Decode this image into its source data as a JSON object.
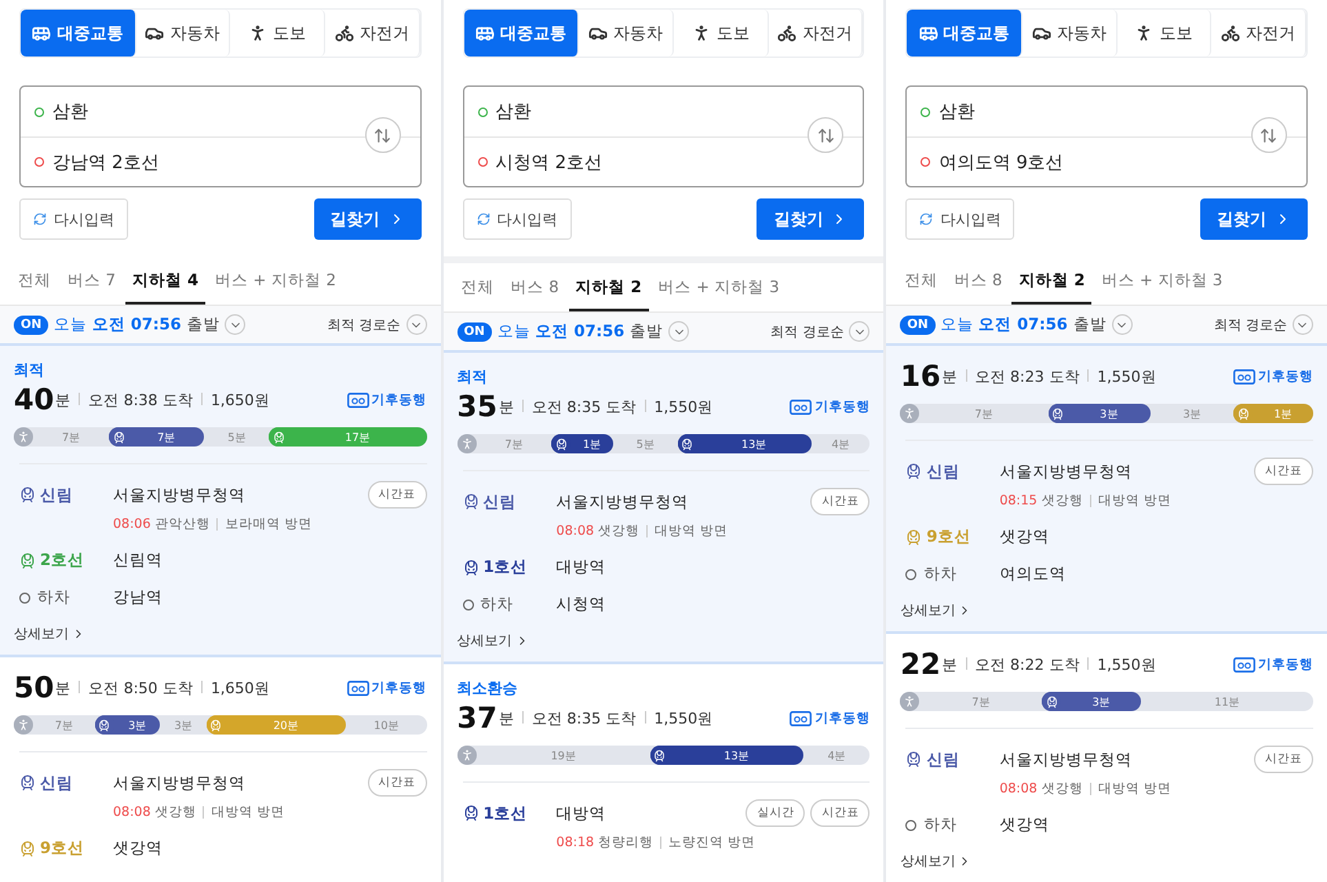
{
  "panels": [
    {
      "modes": [
        {
          "kind": "transit",
          "label": "대중교통",
          "selected": true
        },
        {
          "kind": "car",
          "label": "자동차",
          "selected": false
        },
        {
          "kind": "walk",
          "label": "도보",
          "selected": false
        },
        {
          "kind": "bike",
          "label": "자전거",
          "selected": false
        }
      ],
      "origin": "삼환",
      "destination": "강남역 2호선",
      "reset_button": "다시입력",
      "search_button": "길찾기",
      "tabs": [
        {
          "label": "전체",
          "selected": false
        },
        {
          "label": "버스 7",
          "selected": false
        },
        {
          "label": "지하철 4",
          "selected": true
        },
        {
          "label": "버스 + 지하철 2",
          "selected": false
        }
      ],
      "departure": {
        "on": true,
        "toggle": "ON",
        "time": "오늘 **오전 07:56**",
        "suffix": "출발"
      },
      "sort": "최적 경로순",
      "routes": [
        {
          "selected": true,
          "tag": "최적",
          "minutes": "40",
          "unit": "분",
          "arrival": "오전 8:38 도착",
          "fare": "1,650원",
          "badge": "기후동행",
          "segments": [
            {
              "kind": "walk",
              "label": "7분"
            },
            {
              "kind": "ride",
              "label": "7분",
              "color": "#4b5aa8"
            },
            {
              "kind": "gap",
              "label": "5분"
            },
            {
              "kind": "ride",
              "label": "17분",
              "color": "#3cb44b"
            }
          ],
          "steps": [
            {
              "kind": "board",
              "line": "신림",
              "color": "#4b5aa8",
              "station": "서울지방병무청역",
              "time": "08:06",
              "direction": "관악산행",
              "platform": "보라매역 방면",
              "buttons": [
                "시간표"
              ]
            },
            {
              "kind": "board",
              "line": "2호선",
              "color": "#3ca54b",
              "station": "신림역"
            },
            {
              "kind": "alight",
              "line": "하차",
              "station": "강남역"
            }
          ],
          "detail": "상세보기"
        },
        {
          "selected": false,
          "minutes": "50",
          "unit": "분",
          "arrival": "오전 8:50 도착",
          "fare": "1,650원",
          "badge": "기후동행",
          "segments": [
            {
              "kind": "walk",
              "label": "7분"
            },
            {
              "kind": "ride",
              "label": "3분",
              "color": "#4b5aa8"
            },
            {
              "kind": "gap",
              "label": "3분"
            },
            {
              "kind": "ride",
              "label": "20분",
              "color": "#d4a62a"
            },
            {
              "kind": "gap",
              "label": "10분"
            }
          ],
          "steps": [
            {
              "kind": "board",
              "line": "신림",
              "color": "#4b5aa8",
              "station": "서울지방병무청역",
              "time": "08:08",
              "direction": "샛강행",
              "platform": "대방역 방면",
              "buttons": [
                "시간표"
              ]
            },
            {
              "kind": "board",
              "line": "9호선",
              "color": "#c9a030",
              "station": "샛강역"
            }
          ]
        }
      ]
    },
    {
      "modes": [
        {
          "kind": "transit",
          "label": "대중교통",
          "selected": true
        },
        {
          "kind": "car",
          "label": "자동차",
          "selected": false
        },
        {
          "kind": "walk",
          "label": "도보",
          "selected": false
        },
        {
          "kind": "bike",
          "label": "자전거",
          "selected": false
        }
      ],
      "origin": "삼환",
      "destination": "시청역 2호선",
      "reset_button": "다시입력",
      "search_button": "길찾기",
      "tabs": [
        {
          "label": "전체",
          "selected": false
        },
        {
          "label": "버스 8",
          "selected": false
        },
        {
          "label": "지하철 2",
          "selected": true
        },
        {
          "label": "버스 + 지하철 3",
          "selected": false
        }
      ],
      "departure": {
        "on": true,
        "toggle": "ON",
        "time": "오늘 **오전 07:56**",
        "suffix": "출발"
      },
      "sort": "최적 경로순",
      "routes": [
        {
          "selected": true,
          "tag": "최적",
          "minutes": "35",
          "unit": "분",
          "arrival": "오전 8:35 도착",
          "fare": "1,550원",
          "badge": "기후동행",
          "segments": [
            {
              "kind": "walk",
              "label": "7분"
            },
            {
              "kind": "ride",
              "label": "1분",
              "color": "#2a3f9a"
            },
            {
              "kind": "gap",
              "label": "5분"
            },
            {
              "kind": "ride",
              "label": "13분",
              "color": "#2a3f9a"
            },
            {
              "kind": "gap",
              "label": "4분"
            }
          ],
          "steps": [
            {
              "kind": "board",
              "line": "신림",
              "color": "#4b5aa8",
              "station": "서울지방병무청역",
              "time": "08:08",
              "direction": "샛강행",
              "platform": "대방역 방면",
              "buttons": [
                "시간표"
              ]
            },
            {
              "kind": "board",
              "line": "1호선",
              "color": "#2a3f9a",
              "station": "대방역"
            },
            {
              "kind": "alight",
              "line": "하차",
              "station": "시청역"
            }
          ],
          "detail": "상세보기"
        },
        {
          "selected": false,
          "tag": "최소환승",
          "minutes": "37",
          "unit": "분",
          "arrival": "오전 8:35 도착",
          "fare": "1,550원",
          "badge": "기후동행",
          "segments": [
            {
              "kind": "walk",
              "label": "19분"
            },
            {
              "kind": "ride",
              "label": "13분",
              "color": "#2a3f9a"
            },
            {
              "kind": "gap",
              "label": "4분"
            }
          ],
          "steps": [
            {
              "kind": "board",
              "line": "1호선",
              "color": "#2a3f9a",
              "station": "대방역",
              "time": "08:18",
              "direction": "청량리행",
              "platform": "노량진역 방면",
              "buttons": [
                "실시간",
                "시간표"
              ]
            }
          ]
        }
      ]
    },
    {
      "modes": [
        {
          "kind": "transit",
          "label": "대중교통",
          "selected": true
        },
        {
          "kind": "car",
          "label": "자동차",
          "selected": false
        },
        {
          "kind": "walk",
          "label": "도보",
          "selected": false
        },
        {
          "kind": "bike",
          "label": "자전거",
          "selected": false
        }
      ],
      "origin": "삼환",
      "destination": "여의도역 9호선",
      "reset_button": "다시입력",
      "search_button": "길찾기",
      "tabs": [
        {
          "label": "전체",
          "selected": false
        },
        {
          "label": "버스 8",
          "selected": false
        },
        {
          "label": "지하철 2",
          "selected": true
        },
        {
          "label": "버스 + 지하철 3",
          "selected": false
        }
      ],
      "departure": {
        "on": true,
        "toggle": "ON",
        "time": "오늘 **오전 07:56**",
        "suffix": "출발"
      },
      "sort": "최적 경로순",
      "routes": [
        {
          "selected": true,
          "minutes": "16",
          "unit": "분",
          "arrival": "오전 8:23 도착",
          "fare": "1,550원",
          "badge": "기후동행",
          "segments": [
            {
              "kind": "walk",
              "label": "7분"
            },
            {
              "kind": "ride",
              "label": "3분",
              "color": "#4b5aa8"
            },
            {
              "kind": "gap",
              "label": "3분"
            },
            {
              "kind": "ride",
              "label": "1분",
              "color": "#c9a030"
            }
          ],
          "steps": [
            {
              "kind": "board",
              "line": "신림",
              "color": "#4b5aa8",
              "station": "서울지방병무청역",
              "time": "08:15",
              "direction": "샛강행",
              "platform": "대방역 방면",
              "buttons": [
                "시간표"
              ]
            },
            {
              "kind": "board",
              "line": "9호선",
              "color": "#c9a030",
              "station": "샛강역"
            },
            {
              "kind": "alight",
              "line": "하차",
              "station": "여의도역"
            }
          ],
          "detail": "상세보기"
        },
        {
          "selected": false,
          "minutes": "22",
          "unit": "분",
          "arrival": "오전 8:22 도착",
          "fare": "1,550원",
          "badge": "기후동행",
          "segments": [
            {
              "kind": "walk",
              "label": "7분"
            },
            {
              "kind": "ride",
              "label": "3분",
              "color": "#4b5aa8"
            },
            {
              "kind": "gap",
              "label": "11분"
            }
          ],
          "steps": [
            {
              "kind": "board",
              "line": "신림",
              "color": "#4b5aa8",
              "station": "서울지방병무청역",
              "time": "08:08",
              "direction": "샛강행",
              "platform": "대방역 방면",
              "buttons": [
                "시간표"
              ]
            },
            {
              "kind": "alight",
              "line": "하차",
              "station": "샛강역"
            }
          ],
          "detail": "상세보기"
        }
      ]
    }
  ]
}
